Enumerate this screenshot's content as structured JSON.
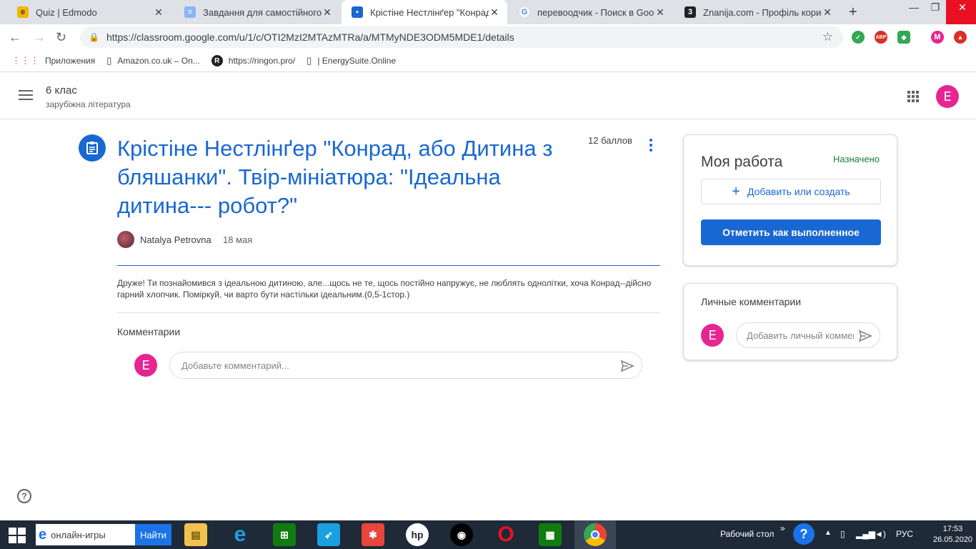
{
  "browser": {
    "tabs": [
      {
        "title": "Quiz | Edmodo",
        "icon": "edmodo-icon",
        "color": "#f4b400"
      },
      {
        "title": "Завдання для самостійного опр",
        "icon": "doc-icon",
        "color": "#4285f4"
      },
      {
        "title": "Крістіне Нестлінґер \"Конрад, аб",
        "icon": "classroom-icon",
        "color": "#1967d2"
      },
      {
        "title": "перевоодчик - Поиск в Google",
        "icon": "google-icon",
        "color": "#4285f4"
      },
      {
        "title": "Znanija.com - Профіль користув",
        "icon": "znanija-icon",
        "color": "#222222"
      }
    ],
    "new_tab": "+",
    "url": "https://classroom.google.com/u/1/c/OTI2MzI2MTAzMTRa/a/MTMyNDE3ODM5MDE1/details",
    "extensions": [
      "check-extension-icon",
      "adblock-icon",
      "shield-extension-icon",
      "profile-m-icon",
      "upload-extension-icon"
    ],
    "profile_letter": "M",
    "abp_label": "ABP",
    "bookmarks": [
      {
        "label": "Приложения",
        "icon": "apps-grid-icon"
      },
      {
        "label": "Amazon.co.uk – On...",
        "icon": "page-icon"
      },
      {
        "label": "https://ringon.pro/",
        "icon": "ringon-icon"
      },
      {
        "label": "| EnergySuite.Online",
        "icon": "page-icon"
      }
    ]
  },
  "classroom": {
    "class_name": "6 клас",
    "class_subject": "зарубіжна література",
    "user_initial": "E"
  },
  "assignment": {
    "title": "Крістіне Нестлінґер \"Конрад, або Дитина з бляшанки\". Твір-мініатюра: \"Ідеальна дитина--- робот?\"",
    "points": "12 баллов",
    "author": "Natalya Petrovna",
    "date": "18 мая",
    "description": "Друже! Ти познайомився з ідеальною дитиною, але...щось не те, щось постійно напружує, не люблять однолітки, хоча Конрад--дійсно гарний хлопчик. Поміркуй, чи варто бути настільки ідеальним.(0,5-1стор.)",
    "comments_header": "Комментарии",
    "comment_placeholder": "Добавьте комментарий..."
  },
  "my_work": {
    "title": "Моя работа",
    "status": "Назначено",
    "add_label": "Добавить или создать",
    "mark_done_label": "Отметить как выполненное"
  },
  "private_comments": {
    "title": "Личные комментарии",
    "placeholder": "Добавить личный комментарий..."
  },
  "taskbar": {
    "search_text": "онлайн-игры",
    "search_button": "Найти",
    "apps": [
      "file-explorer-icon",
      "internet-explorer-icon",
      "store-icon",
      "rocket-app-icon",
      "puzzle-app-icon",
      "hp-icon",
      "camera-app-icon",
      "opera-icon",
      "calculator-icon",
      "chrome-icon"
    ],
    "desktop_label": "Рабочий стол",
    "language": "РУС",
    "time": "17:53",
    "date": "26.05.2020"
  },
  "colors": {
    "accent": "#1967d2",
    "status_green": "#188038",
    "avatar_pink": "#e52592"
  }
}
